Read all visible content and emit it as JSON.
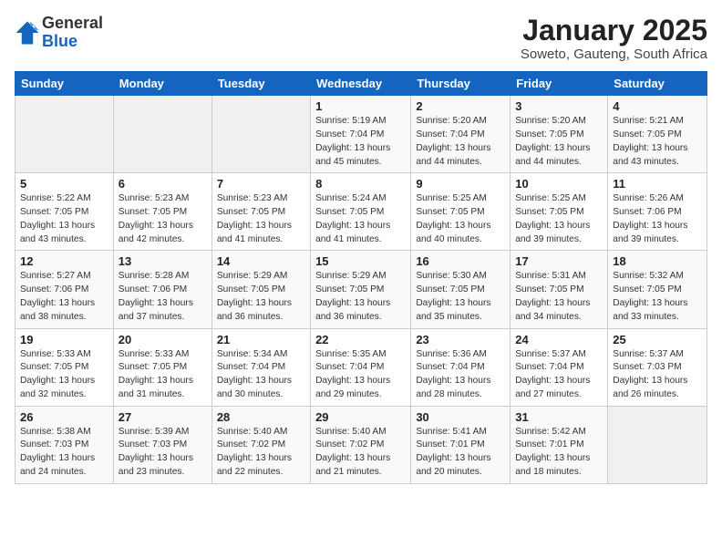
{
  "logo": {
    "general": "General",
    "blue": "Blue"
  },
  "title": "January 2025",
  "subtitle": "Soweto, Gauteng, South Africa",
  "headers": [
    "Sunday",
    "Monday",
    "Tuesday",
    "Wednesday",
    "Thursday",
    "Friday",
    "Saturday"
  ],
  "weeks": [
    [
      {
        "day": "",
        "info": ""
      },
      {
        "day": "",
        "info": ""
      },
      {
        "day": "",
        "info": ""
      },
      {
        "day": "1",
        "info": "Sunrise: 5:19 AM\nSunset: 7:04 PM\nDaylight: 13 hours\nand 45 minutes."
      },
      {
        "day": "2",
        "info": "Sunrise: 5:20 AM\nSunset: 7:04 PM\nDaylight: 13 hours\nand 44 minutes."
      },
      {
        "day": "3",
        "info": "Sunrise: 5:20 AM\nSunset: 7:05 PM\nDaylight: 13 hours\nand 44 minutes."
      },
      {
        "day": "4",
        "info": "Sunrise: 5:21 AM\nSunset: 7:05 PM\nDaylight: 13 hours\nand 43 minutes."
      }
    ],
    [
      {
        "day": "5",
        "info": "Sunrise: 5:22 AM\nSunset: 7:05 PM\nDaylight: 13 hours\nand 43 minutes."
      },
      {
        "day": "6",
        "info": "Sunrise: 5:23 AM\nSunset: 7:05 PM\nDaylight: 13 hours\nand 42 minutes."
      },
      {
        "day": "7",
        "info": "Sunrise: 5:23 AM\nSunset: 7:05 PM\nDaylight: 13 hours\nand 41 minutes."
      },
      {
        "day": "8",
        "info": "Sunrise: 5:24 AM\nSunset: 7:05 PM\nDaylight: 13 hours\nand 41 minutes."
      },
      {
        "day": "9",
        "info": "Sunrise: 5:25 AM\nSunset: 7:05 PM\nDaylight: 13 hours\nand 40 minutes."
      },
      {
        "day": "10",
        "info": "Sunrise: 5:25 AM\nSunset: 7:05 PM\nDaylight: 13 hours\nand 39 minutes."
      },
      {
        "day": "11",
        "info": "Sunrise: 5:26 AM\nSunset: 7:06 PM\nDaylight: 13 hours\nand 39 minutes."
      }
    ],
    [
      {
        "day": "12",
        "info": "Sunrise: 5:27 AM\nSunset: 7:06 PM\nDaylight: 13 hours\nand 38 minutes."
      },
      {
        "day": "13",
        "info": "Sunrise: 5:28 AM\nSunset: 7:06 PM\nDaylight: 13 hours\nand 37 minutes."
      },
      {
        "day": "14",
        "info": "Sunrise: 5:29 AM\nSunset: 7:05 PM\nDaylight: 13 hours\nand 36 minutes."
      },
      {
        "day": "15",
        "info": "Sunrise: 5:29 AM\nSunset: 7:05 PM\nDaylight: 13 hours\nand 36 minutes."
      },
      {
        "day": "16",
        "info": "Sunrise: 5:30 AM\nSunset: 7:05 PM\nDaylight: 13 hours\nand 35 minutes."
      },
      {
        "day": "17",
        "info": "Sunrise: 5:31 AM\nSunset: 7:05 PM\nDaylight: 13 hours\nand 34 minutes."
      },
      {
        "day": "18",
        "info": "Sunrise: 5:32 AM\nSunset: 7:05 PM\nDaylight: 13 hours\nand 33 minutes."
      }
    ],
    [
      {
        "day": "19",
        "info": "Sunrise: 5:33 AM\nSunset: 7:05 PM\nDaylight: 13 hours\nand 32 minutes."
      },
      {
        "day": "20",
        "info": "Sunrise: 5:33 AM\nSunset: 7:05 PM\nDaylight: 13 hours\nand 31 minutes."
      },
      {
        "day": "21",
        "info": "Sunrise: 5:34 AM\nSunset: 7:04 PM\nDaylight: 13 hours\nand 30 minutes."
      },
      {
        "day": "22",
        "info": "Sunrise: 5:35 AM\nSunset: 7:04 PM\nDaylight: 13 hours\nand 29 minutes."
      },
      {
        "day": "23",
        "info": "Sunrise: 5:36 AM\nSunset: 7:04 PM\nDaylight: 13 hours\nand 28 minutes."
      },
      {
        "day": "24",
        "info": "Sunrise: 5:37 AM\nSunset: 7:04 PM\nDaylight: 13 hours\nand 27 minutes."
      },
      {
        "day": "25",
        "info": "Sunrise: 5:37 AM\nSunset: 7:03 PM\nDaylight: 13 hours\nand 26 minutes."
      }
    ],
    [
      {
        "day": "26",
        "info": "Sunrise: 5:38 AM\nSunset: 7:03 PM\nDaylight: 13 hours\nand 24 minutes."
      },
      {
        "day": "27",
        "info": "Sunrise: 5:39 AM\nSunset: 7:03 PM\nDaylight: 13 hours\nand 23 minutes."
      },
      {
        "day": "28",
        "info": "Sunrise: 5:40 AM\nSunset: 7:02 PM\nDaylight: 13 hours\nand 22 minutes."
      },
      {
        "day": "29",
        "info": "Sunrise: 5:40 AM\nSunset: 7:02 PM\nDaylight: 13 hours\nand 21 minutes."
      },
      {
        "day": "30",
        "info": "Sunrise: 5:41 AM\nSunset: 7:01 PM\nDaylight: 13 hours\nand 20 minutes."
      },
      {
        "day": "31",
        "info": "Sunrise: 5:42 AM\nSunset: 7:01 PM\nDaylight: 13 hours\nand 18 minutes."
      },
      {
        "day": "",
        "info": ""
      }
    ]
  ]
}
